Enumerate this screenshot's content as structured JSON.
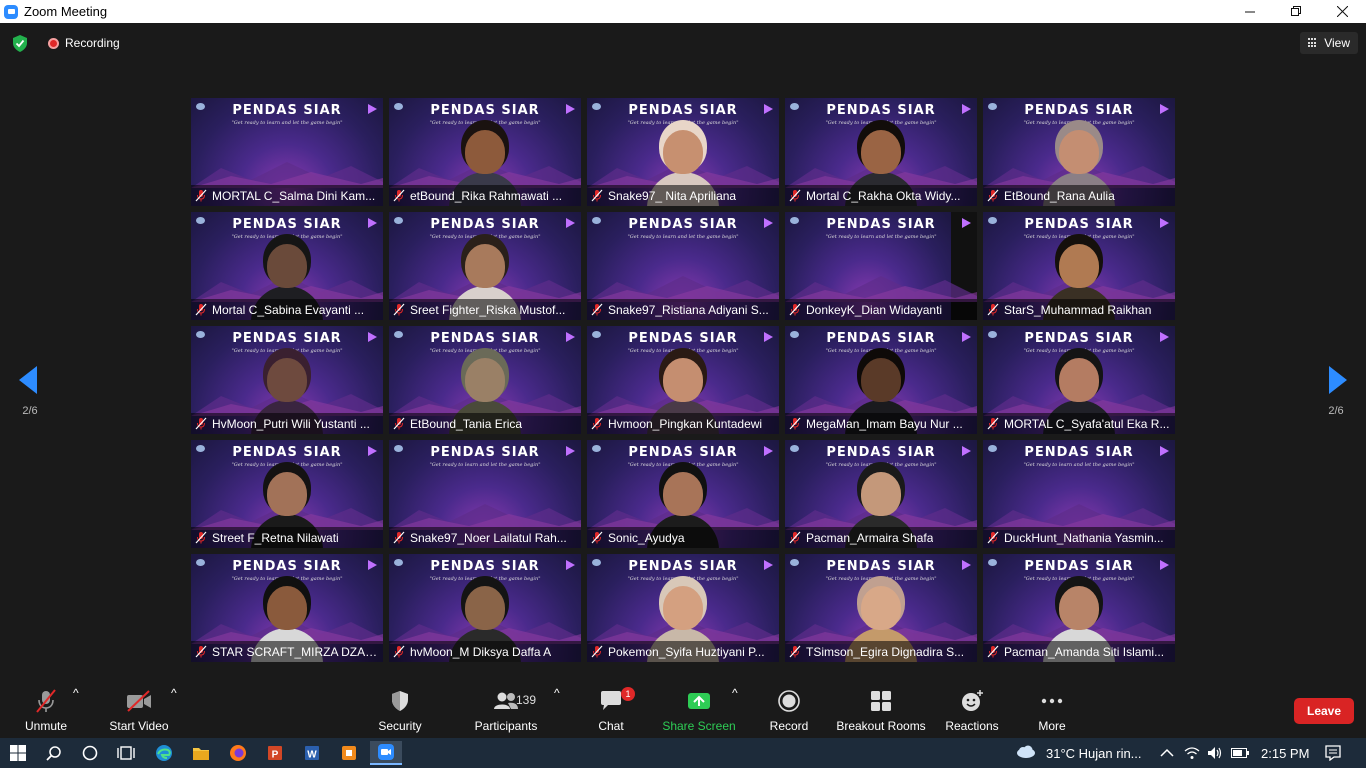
{
  "window": {
    "title": "Zoom Meeting",
    "controls": [
      "minimize",
      "restore",
      "close"
    ]
  },
  "meeting_bar": {
    "recording_label": "Recording",
    "view_label": "View"
  },
  "pager": {
    "left": "2/6",
    "right": "2/6"
  },
  "tiles": [
    {
      "name": "MORTAL C_Salma Dini Kam...",
      "banner": "PENDAS SIAR",
      "tagline": "\"Get ready to learn and let the game begin\"",
      "person": false
    },
    {
      "name": "etBound_Rika Rahmawati ...",
      "banner": "PENDAS SIAR",
      "tagline": "\"Get ready to learn and let the game begin\"",
      "person": true,
      "skin": "#8d5a3b",
      "hair": "#1a1210",
      "shirt": "#3a3a4a"
    },
    {
      "name": "Snake97_ Nita Apriliana",
      "banner": "PENDAS SIAR",
      "tagline": "\"Get ready to learn and let the game begin\"",
      "person": true,
      "skin": "#c79070",
      "hair": "#e8d6c8",
      "shirt": "#d8c8c0"
    },
    {
      "name": "Mortal C_Rakha Okta Widy...",
      "banner": "PENDAS SIAR",
      "tagline": "\"Get ready to learn and let the game begin\"",
      "person": true,
      "skin": "#9a6444",
      "hair": "#120d0a",
      "shirt": "#2a2a30"
    },
    {
      "name": "EtBound_Rana Aulia",
      "banner": "PENDAS SIAR",
      "tagline": "\"Get ready to learn and let the game begin\"",
      "person": true,
      "skin": "#c48e72",
      "hair": "#9a8a88",
      "shirt": "#8a7f86"
    },
    {
      "name": "Mortal C_Sabina Evayanti ...",
      "banner": "PENDAS SIAR",
      "tagline": "\"Get ready to learn and let the game begin\"",
      "person": true,
      "skin": "#6a4a3a",
      "hair": "#151515",
      "shirt": "#1e1e22"
    },
    {
      "name": "Sreet Fighter_Riska Mustof...",
      "banner": "PENDAS SIAR",
      "tagline": "\"Get ready to learn and let the game begin\"",
      "person": true,
      "skin": "#a87a5c",
      "hair": "#2a201a",
      "shirt": "#d8d0cc"
    },
    {
      "name": "Snake97_Ristiana Adiyani S...",
      "banner": "PENDAS SIAR",
      "tagline": "\"Get ready to learn and let the game begin\"",
      "person": false
    },
    {
      "name": "DonkeyK_Dian Widayanti",
      "banner": "PENDAS SIAR",
      "tagline": "\"Get ready to learn and let the game begin\"",
      "person": false,
      "black": true
    },
    {
      "name": "StarS_Muhammad Raikhan",
      "banner": "PENDAS SIAR",
      "tagline": "\"Get ready to learn and let the game begin\"",
      "person": true,
      "skin": "#b07a52",
      "hair": "#15100c",
      "shirt": "#3a3024"
    },
    {
      "name": "HvMoon_Putri Wili Yustanti ...",
      "banner": "PENDAS SIAR",
      "tagline": "\"Get ready to learn and let the game begin\"",
      "person": true,
      "skin": "#6e4a3e",
      "hair": "#3a2030",
      "shirt": "#3a2540"
    },
    {
      "name": "EtBound_Tania Erica",
      "banner": "PENDAS SIAR",
      "tagline": "\"Get ready to learn and let the game begin\"",
      "person": true,
      "skin": "#9a8066",
      "hair": "#6a6a58",
      "shirt": "#4a4a3a"
    },
    {
      "name": "Hvmoon_Pingkan Kuntadewi",
      "banner": "PENDAS SIAR",
      "tagline": "\"Get ready to learn and let the game begin\"",
      "person": true,
      "skin": "#c58e70",
      "hair": "#2a1a14",
      "shirt": "#4a3a48"
    },
    {
      "name": "MegaMan_Imam Bayu Nur ...",
      "banner": "PENDAS SIAR",
      "tagline": "\"Get ready to learn and let the game begin\"",
      "person": true,
      "skin": "#5a3a28",
      "hair": "#0e0a08",
      "shirt": "#1a1a1e"
    },
    {
      "name": "MORTAL C_Syafa'atul Eka R...",
      "banner": "PENDAS SIAR",
      "tagline": "\"Get ready to learn and let the game begin\"",
      "person": true,
      "skin": "#b47c62",
      "hair": "#141414",
      "shirt": "#202028"
    },
    {
      "name": "Street F_Retna Nilawati",
      "banner": "PENDAS SIAR",
      "tagline": "\"Get ready to learn and let the game begin\"",
      "person": true,
      "skin": "#a27258",
      "hair": "#141212",
      "shirt": "#1a1a1a"
    },
    {
      "name": "Snake97_Noer Lailatul Rah...",
      "banner": "PENDAS SIAR",
      "tagline": "\"Get ready to learn and let the game begin\"",
      "person": false
    },
    {
      "name": "Sonic_Ayudya",
      "banner": "PENDAS SIAR",
      "tagline": "\"Get ready to learn and let the game begin\"",
      "person": true,
      "skin": "#a87458",
      "hair": "#111111",
      "shirt": "#1c1c1c"
    },
    {
      "name": "Pacman_Armaira Shafa",
      "banner": "PENDAS SIAR",
      "tagline": "\"Get ready to learn and let the game begin\"",
      "person": true,
      "skin": "#c4987a",
      "hair": "#1a1a1a",
      "shirt": "#2a2a2a"
    },
    {
      "name": "DuckHunt_Nathania Yasmin...",
      "banner": "PENDAS SIAR",
      "tagline": "\"Get ready to learn and let the game begin\"",
      "person": false
    },
    {
      "name": "STAR SCRAFT_MIRZA DZAK...",
      "banner": "PENDAS SIAR",
      "tagline": "\"Get ready to learn and let the game begin\"",
      "person": true,
      "skin": "#8a5a3c",
      "hair": "#101010",
      "shirt": "#d8d8d8"
    },
    {
      "name": "hvMoon_M Diksya Daffa A",
      "banner": "PENDAS SIAR",
      "tagline": "\"Get ready to learn and let the game begin\"",
      "person": true,
      "skin": "#8a6448",
      "hair": "#141414",
      "shirt": "#2a2a2a"
    },
    {
      "name": "Pokemon_Syifa Huztiyani P...",
      "banner": "PENDAS SIAR",
      "tagline": "\"Get ready to learn and let the game begin\"",
      "person": true,
      "skin": "#d4a080",
      "hair": "#d8c8b8",
      "shirt": "#c8b8a8"
    },
    {
      "name": "TSimson_Egira Dignadira S...",
      "banner": "PENDAS SIAR",
      "tagline": "\"Get ready to learn and let the game begin\"",
      "person": true,
      "skin": "#d8a888",
      "hair": "#c0a090",
      "shirt": "#c49a6a"
    },
    {
      "name": "Pacman_Amanda Siti Islami...",
      "banner": "PENDAS SIAR",
      "tagline": "\"Get ready to learn and let the game begin\"",
      "person": true,
      "skin": "#b88468",
      "hair": "#141414",
      "shirt": "#d8d8d8"
    }
  ],
  "toolbar": {
    "unmute": "Unmute",
    "start_video": "Start Video",
    "security": "Security",
    "participants": "Participants",
    "participants_count": "139",
    "chat": "Chat",
    "chat_badge": "1",
    "share_screen": "Share Screen",
    "record": "Record",
    "breakout_rooms": "Breakout Rooms",
    "reactions": "Reactions",
    "more": "More",
    "leave": "Leave"
  },
  "taskbar": {
    "apps": [
      "windows-start",
      "search",
      "cortana",
      "task-view",
      "edge",
      "file-explorer",
      "firefox",
      "powerpoint",
      "word",
      "orange-app",
      "zoom"
    ],
    "weather": "31°C  Hujan rin...",
    "time": "2:15 PM"
  },
  "colors": {
    "accent": "#2d8cff",
    "leave": "#d92424",
    "share": "#2ecc55",
    "mute_red": "#e02828"
  }
}
